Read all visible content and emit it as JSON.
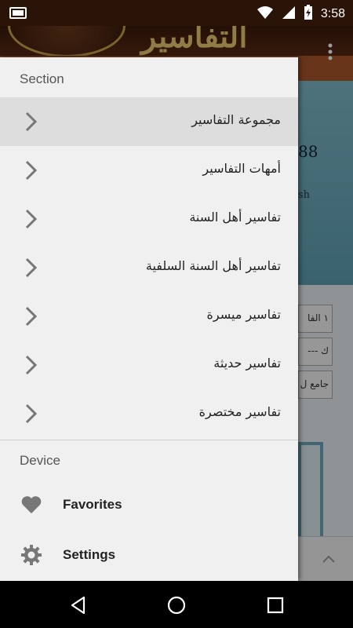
{
  "status_bar": {
    "time": "3:58",
    "icons": [
      "notification-icon",
      "wifi-icon",
      "signal-icon",
      "battery-charging-icon"
    ]
  },
  "app": {
    "title": "التفاسير",
    "banner_number": "88",
    "banner_text": "sh",
    "fields": [
      "١ الفا",
      "--- ك",
      "جامع ل"
    ]
  },
  "drawer": {
    "section_header": "Section",
    "items": [
      {
        "label": "مجموعة التفاسير",
        "selected": true
      },
      {
        "label": "أمهات التفاسير",
        "selected": false
      },
      {
        "label": "تفاسير أهل السنة",
        "selected": false
      },
      {
        "label": "تفاسير أهل السنة السلفية",
        "selected": false
      },
      {
        "label": "تفاسير ميسرة",
        "selected": false
      },
      {
        "label": "تفاسير حديثة",
        "selected": false
      },
      {
        "label": "تفاسير مختصرة",
        "selected": false
      }
    ],
    "device_header": "Device",
    "device_items": [
      {
        "label": "Favorites",
        "icon": "heart-icon"
      },
      {
        "label": "Settings",
        "icon": "gear-icon"
      }
    ]
  },
  "nav_bar": {
    "buttons": [
      "back-icon",
      "home-icon",
      "recents-icon"
    ]
  }
}
